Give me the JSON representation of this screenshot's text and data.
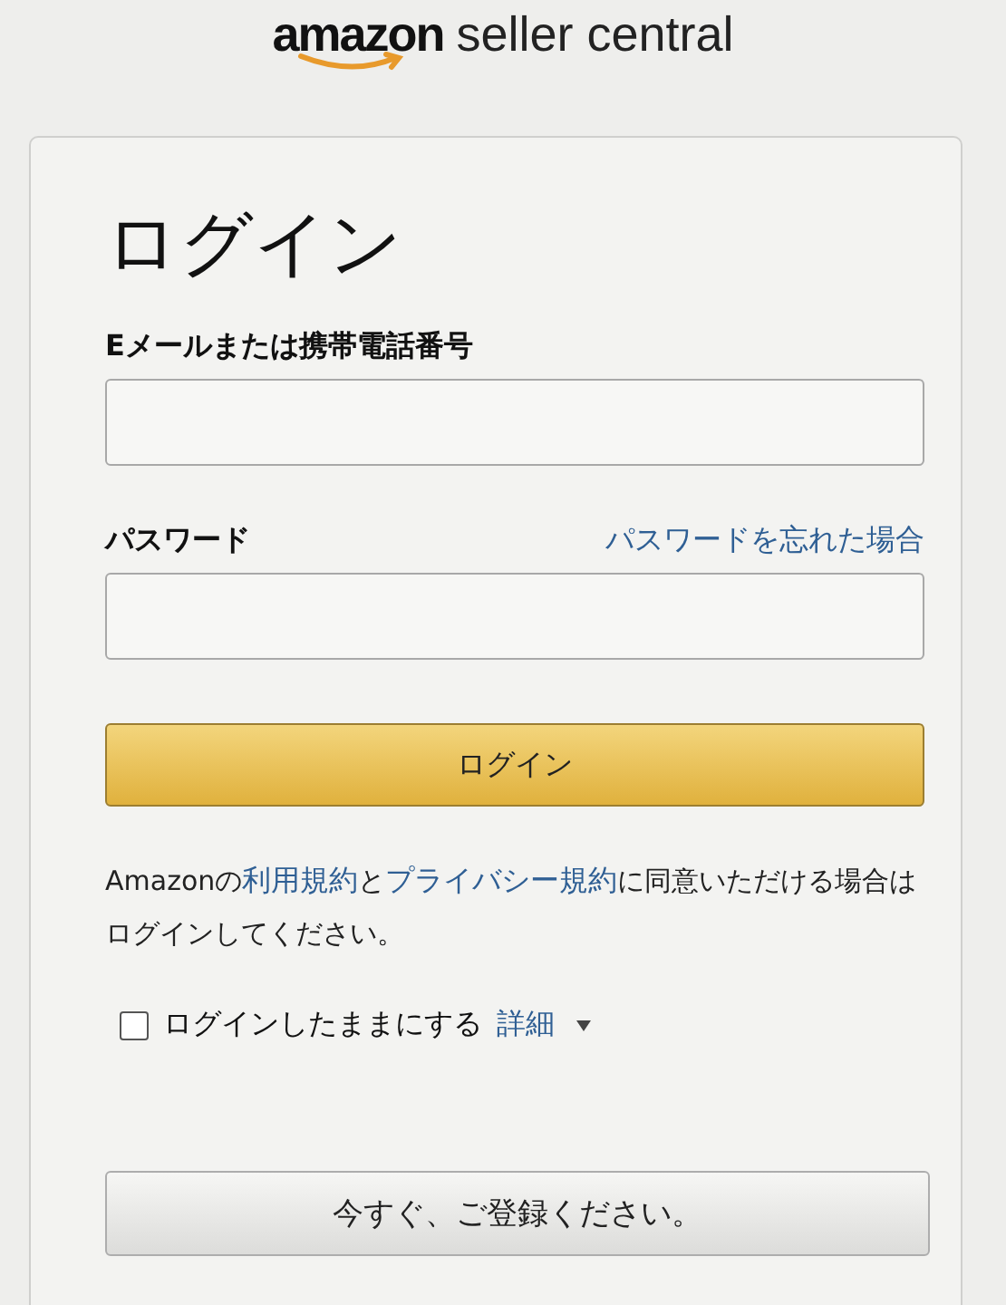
{
  "logo": {
    "brand": "amazon",
    "product": "seller central"
  },
  "title": "ログイン",
  "email": {
    "label": "Eメールまたは携帯電話番号"
  },
  "password": {
    "label": "パスワード",
    "forgot_link": "パスワードを忘れた場合"
  },
  "login_button": "ログイン",
  "terms": {
    "prefix": "Amazonの",
    "link_1": "利用規約",
    "middle": "と",
    "link_2": "プライバシー規約",
    "suffix": "に同意いただける場合はログインしてください。"
  },
  "remember": {
    "label": "ログインしたままにする",
    "checked": false,
    "details_link": "詳細"
  },
  "register_button": "今すぐ、ご登録ください。"
}
